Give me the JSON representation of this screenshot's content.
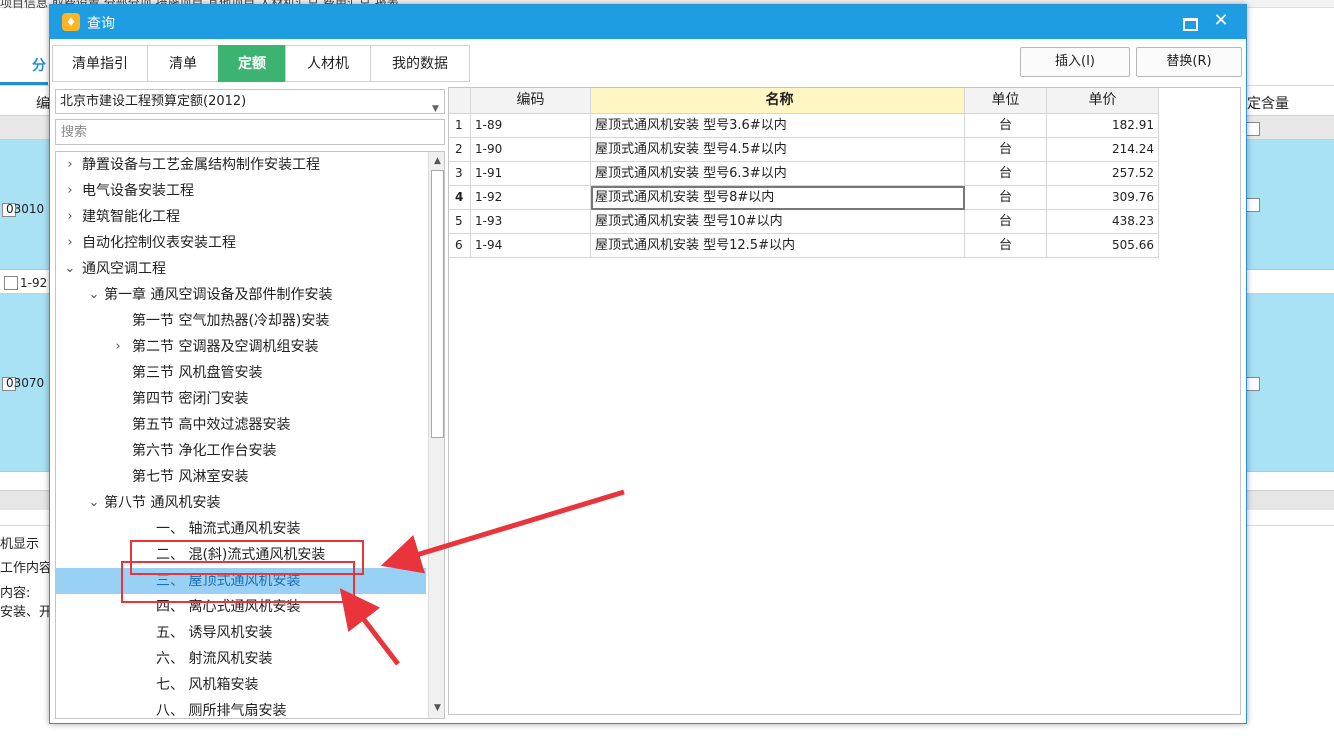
{
  "background_app": {
    "top_text": "项目信息   取费设置   分部分项   措施项目   其他项目   人材机汇总   费用汇总   报表",
    "tab_fen": "分",
    "col_bian": "编",
    "col_dinghanliang": "定含量",
    "row_codes": [
      "03010",
      "1-92",
      "03070"
    ],
    "bottom_texts": [
      "机显示",
      "工作内容和",
      "内容:",
      "安装、开箱"
    ]
  },
  "dialog": {
    "title": "查询",
    "icon_glyph": "♦",
    "maximize_icon": "maximize-icon",
    "close_icon": "close-icon",
    "tabs": [
      {
        "label": "清单指引",
        "active": false
      },
      {
        "label": "清单",
        "active": false
      },
      {
        "label": "定额",
        "active": true
      },
      {
        "label": "人材机",
        "active": false
      },
      {
        "label": "我的数据",
        "active": false
      }
    ],
    "insert_label": "插入(I)",
    "replace_label": "替换(R)",
    "library_select": "北京市建设工程预算定额(2012)",
    "search_placeholder": "搜索",
    "tree": [
      {
        "label": "静置设备与工艺金属结构制作安装工程",
        "level": 0,
        "arrow": "›",
        "selected": false
      },
      {
        "label": "电气设备安装工程",
        "level": 0,
        "arrow": "›",
        "selected": false
      },
      {
        "label": "建筑智能化工程",
        "level": 0,
        "arrow": "›",
        "selected": false
      },
      {
        "label": "自动化控制仪表安装工程",
        "level": 0,
        "arrow": "›",
        "selected": false
      },
      {
        "label": "通风空调工程",
        "level": 0,
        "arrow": "⌄",
        "selected": false
      },
      {
        "label": "第一章 通风空调设备及部件制作安装",
        "level": 1,
        "arrow": "⌄",
        "selected": false
      },
      {
        "label": "第一节 空气加热器(冷却器)安装",
        "level": 2,
        "arrow": "",
        "selected": false
      },
      {
        "label": "第二节 空调器及空调机组安装",
        "level": 2,
        "arrow": "›",
        "selected": false
      },
      {
        "label": "第三节 风机盘管安装",
        "level": 2,
        "arrow": "",
        "selected": false
      },
      {
        "label": "第四节 密闭门安装",
        "level": 2,
        "arrow": "",
        "selected": false
      },
      {
        "label": "第五节 高中效过滤器安装",
        "level": 2,
        "arrow": "",
        "selected": false
      },
      {
        "label": "第六节 净化工作台安装",
        "level": 2,
        "arrow": "",
        "selected": false
      },
      {
        "label": "第七节 风淋室安装",
        "level": 2,
        "arrow": "",
        "selected": false
      },
      {
        "label": "第八节 通风机安装",
        "level": 1,
        "arrow": "⌄",
        "selected": false
      },
      {
        "label": "一、 轴流式通风机安装",
        "level": 3,
        "arrow": "",
        "selected": false
      },
      {
        "label": "二、 混(斜)流式通风机安装",
        "level": 3,
        "arrow": "",
        "selected": false
      },
      {
        "label": "三、 屋顶式通风机安装",
        "level": 3,
        "arrow": "",
        "selected": true
      },
      {
        "label": "四、 离心式通风机安装",
        "level": 3,
        "arrow": "",
        "selected": false
      },
      {
        "label": "五、 诱导风机安装",
        "level": 3,
        "arrow": "",
        "selected": false
      },
      {
        "label": "六、 射流风机安装",
        "level": 3,
        "arrow": "",
        "selected": false
      },
      {
        "label": "七、 风机箱安装",
        "level": 3,
        "arrow": "",
        "selected": false
      },
      {
        "label": "八、 厕所排气扇安装",
        "level": 3,
        "arrow": "",
        "selected": false
      }
    ],
    "grid": {
      "headers": {
        "code": "编码",
        "name": "名称",
        "unit": "单位",
        "price": "单价"
      },
      "rows": [
        {
          "num": "1",
          "code": "1-89",
          "name": "屋顶式通风机安装 型号3.6#以内",
          "unit": "台",
          "price": "182.91"
        },
        {
          "num": "2",
          "code": "1-90",
          "name": "屋顶式通风机安装 型号4.5#以内",
          "unit": "台",
          "price": "214.24"
        },
        {
          "num": "3",
          "code": "1-91",
          "name": "屋顶式通风机安装 型号6.3#以内",
          "unit": "台",
          "price": "257.52"
        },
        {
          "num": "4",
          "code": "1-92",
          "name": "屋顶式通风机安装 型号8#以内",
          "unit": "台",
          "price": "309.76"
        },
        {
          "num": "5",
          "code": "1-93",
          "name": "屋顶式通风机安装 型号10#以内",
          "unit": "台",
          "price": "438.23"
        },
        {
          "num": "6",
          "code": "1-94",
          "name": "屋顶式通风机安装 型号12.5#以内",
          "unit": "台",
          "price": "505.66"
        }
      ],
      "current_row": 3
    },
    "annotation_color": "#e8343a"
  }
}
